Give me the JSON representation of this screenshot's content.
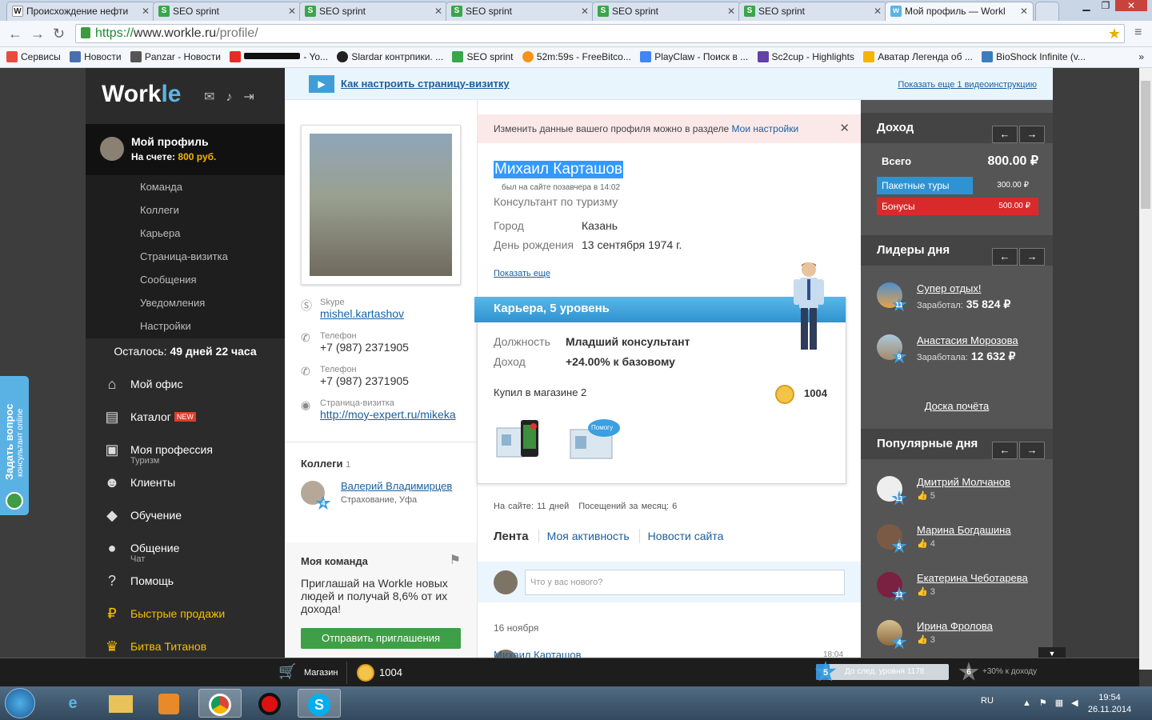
{
  "browser": {
    "tabs": [
      {
        "title": "Происхождение нефти",
        "icon": "W"
      },
      {
        "title": "SEO sprint",
        "icon": "S"
      },
      {
        "title": "SEO sprint",
        "icon": "S"
      },
      {
        "title": "SEO sprint",
        "icon": "S"
      },
      {
        "title": "SEO sprint",
        "icon": "S"
      },
      {
        "title": "SEO sprint",
        "icon": "S"
      },
      {
        "title": "Мой профиль — Workl",
        "icon": "w"
      }
    ],
    "url_https": "https://",
    "url_host": "www.workle.ru",
    "url_path": "/profile/",
    "bookmarks": [
      "Сервисы",
      "Новости",
      "Panzar - Новости",
      "- Yo...",
      "Slardar контрпики. ...",
      "SEO sprint",
      "52m:59s - FreeBitco...",
      "PlayClaw - Поиск в ...",
      "Sc2cup - Highlights",
      "Аватар Легенда об ...",
      "BioShock Infinite (v..."
    ]
  },
  "sidebar": {
    "logo_main": "Work",
    "logo_accent": "le",
    "profile_title": "Мой профиль",
    "balance_label": "На счете:",
    "balance_value": "800 руб.",
    "submenu": [
      "Команда",
      "Коллеги",
      "Карьера",
      "Страница-визитка",
      "Сообщения",
      "Уведомления",
      "Настройки"
    ],
    "remaining_label": "Осталось:",
    "remaining_value": "49 дней 22 часа",
    "menu": [
      {
        "label": "Мой офис",
        "sub": ""
      },
      {
        "label": "Каталог",
        "sub": "",
        "badge": "NEW"
      },
      {
        "label": "Моя профессия",
        "sub": "Туризм"
      },
      {
        "label": "Клиенты",
        "sub": ""
      },
      {
        "label": "Обучение",
        "sub": ""
      },
      {
        "label": "Общение",
        "sub": "Чат"
      },
      {
        "label": "Помощь",
        "sub": ""
      },
      {
        "label": "Быстрые продажи",
        "sub": ""
      },
      {
        "label": "Битва Титанов",
        "sub": ""
      }
    ]
  },
  "feedback": {
    "title": "Задать вопрос",
    "subtitle": "консультант online"
  },
  "videobar": {
    "title": "Как настроить страницу-визитку",
    "more": "Показать еще 1 видеоинструкцию"
  },
  "contacts": {
    "skype_label": "Skype",
    "skype": "mishel.kartashov",
    "phone_label": "Телефон",
    "phone1": "+7 (987) 2371905",
    "phone2": "+7 (987) 2371905",
    "page_label": "Страница-визитка",
    "page_url": "http://moy-expert.ru/mikeka"
  },
  "colleagues": {
    "title": "Коллеги",
    "count": "1",
    "name": "Валерий Владимирцев",
    "desc": "Страхование, Уфа",
    "level": "4"
  },
  "team": {
    "title": "Моя команда",
    "text": "Приглашай на Workle новых людей и получай 8,6% от их дохода!",
    "button": "Отправить приглашения"
  },
  "notice": {
    "text": "Изменить данные вашего профиля можно в разделе ",
    "link": "Мои настройки"
  },
  "profile": {
    "name": "Михаил Карташов",
    "seen": "был на сайте позавчера в 14:02",
    "position": "Консультант по туризму",
    "city_label": "Город",
    "city": "Казань",
    "birth_label": "День рождения",
    "birth": "13 сентября 1974 г.",
    "more": "Показать еще"
  },
  "career": {
    "title": "Карьера, 5 уровень",
    "pos_label": "Должность",
    "pos": "Младший консультант",
    "income_label": "Доход",
    "income": "+24.00% к базовому",
    "shop": "Купил в магазине 2",
    "coins": "1004",
    "item_badge": "Помогу"
  },
  "stats": {
    "days": "На сайте: 11 дней",
    "visits": "Посещений за месяц: 6"
  },
  "feed": {
    "tab1": "Лента",
    "tab2": "Моя активность",
    "tab3": "Новости сайта",
    "placeholder": "Что у вас нового?",
    "date": "16 ноября",
    "post_author": "Михаил Карташов",
    "post_time": "18:04"
  },
  "right": {
    "income_title": "Доход",
    "total_label": "Всего",
    "total": "800.00 ₽",
    "bar1_label": "Пакетные туры",
    "bar1": "300.00 ₽",
    "bar2_label": "Бонусы",
    "bar2": "500.00 ₽",
    "leaders_title": "Лидеры дня",
    "leaders": [
      {
        "name": "Супер отдых!",
        "label": "Заработал:",
        "value": "35 824 ₽",
        "level": "11"
      },
      {
        "name": "Анастасия Морозова",
        "label": "Заработала:",
        "value": "12 632 ₽",
        "level": "9"
      }
    ],
    "honor": "Доска почёта",
    "popular_title": "Популярные дня",
    "popular": [
      {
        "name": "Дмитрий Молчанов",
        "likes": "5",
        "level": "11"
      },
      {
        "name": "Марина Богдашина",
        "likes": "4",
        "level": "5"
      },
      {
        "name": "Екатерина Чеботарева",
        "likes": "3",
        "level": "11"
      },
      {
        "name": "Ирина Фролова",
        "likes": "3",
        "level": "4"
      }
    ]
  },
  "bottombar": {
    "shop": "Магазин",
    "coins": "1004",
    "level": "5",
    "next": "До след. уровня 1178",
    "progress": 0.1,
    "next_level": "6",
    "next_bonus": "+30% к доходу"
  },
  "taskbar": {
    "lang": "RU",
    "time": "19:54",
    "date": "26.11.2014"
  }
}
